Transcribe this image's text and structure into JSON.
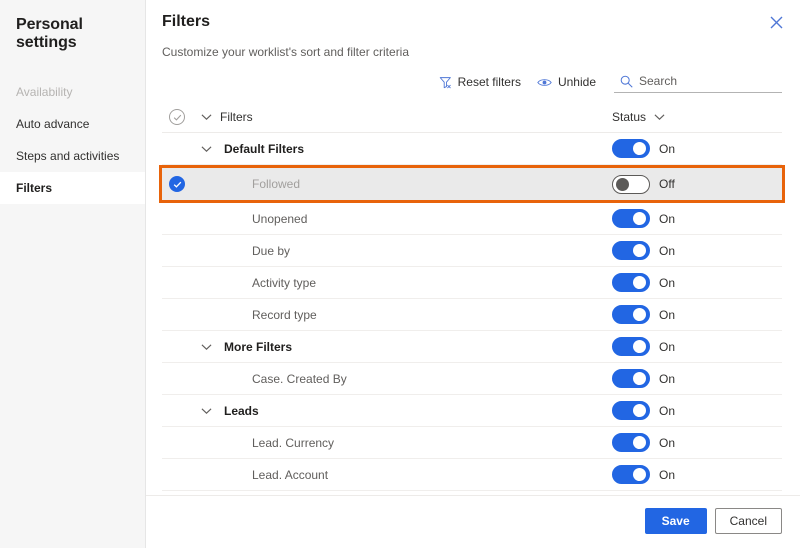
{
  "sidebar": {
    "title": "Personal settings",
    "items": [
      {
        "label": "Availability",
        "state": "disabled"
      },
      {
        "label": "Auto advance",
        "state": "normal"
      },
      {
        "label": "Steps and activities",
        "state": "normal"
      },
      {
        "label": "Filters",
        "state": "selected"
      }
    ]
  },
  "panel": {
    "title": "Filters",
    "subtitle": "Customize your worklist's sort and filter criteria",
    "close_icon": "close-icon"
  },
  "commandbar": {
    "reset_filters": {
      "label": "Reset filters",
      "icon": "filter-clear-icon"
    },
    "unhide": {
      "label": "Unhide",
      "icon": "eye-icon"
    },
    "search": {
      "placeholder": "Search",
      "value": "",
      "icon": "search-icon"
    }
  },
  "grid": {
    "header": {
      "select_all_icon": "circle-check-outline-icon",
      "expand_icon": "chevron-down-icon",
      "name_column": "Filters",
      "status_column": "Status",
      "status_sort_icon": "chevron-down-icon"
    },
    "rows": [
      {
        "label": "Default Filters",
        "level": "group",
        "status": "On",
        "toggle": "on",
        "checked": false,
        "highlighted": false,
        "has_chevron": true
      },
      {
        "label": "Followed",
        "level": "child",
        "status": "Off",
        "toggle": "off",
        "checked": true,
        "highlighted": true,
        "has_chevron": false
      },
      {
        "label": "Unopened",
        "level": "child",
        "status": "On",
        "toggle": "on",
        "checked": false,
        "highlighted": false,
        "has_chevron": false
      },
      {
        "label": "Due by",
        "level": "child",
        "status": "On",
        "toggle": "on",
        "checked": false,
        "highlighted": false,
        "has_chevron": false
      },
      {
        "label": "Activity type",
        "level": "child",
        "status": "On",
        "toggle": "on",
        "checked": false,
        "highlighted": false,
        "has_chevron": false
      },
      {
        "label": "Record type",
        "level": "child",
        "status": "On",
        "toggle": "on",
        "checked": false,
        "highlighted": false,
        "has_chevron": false
      },
      {
        "label": "More Filters",
        "level": "group",
        "status": "On",
        "toggle": "on",
        "checked": false,
        "highlighted": false,
        "has_chevron": true
      },
      {
        "label": "Case. Created By",
        "level": "child",
        "status": "On",
        "toggle": "on",
        "checked": false,
        "highlighted": false,
        "has_chevron": false
      },
      {
        "label": "Leads",
        "level": "group",
        "status": "On",
        "toggle": "on",
        "checked": false,
        "highlighted": false,
        "has_chevron": true
      },
      {
        "label": "Lead. Currency",
        "level": "child",
        "status": "On",
        "toggle": "on",
        "checked": false,
        "highlighted": false,
        "has_chevron": false
      },
      {
        "label": "Lead. Account",
        "level": "child",
        "status": "On",
        "toggle": "on",
        "checked": false,
        "highlighted": false,
        "has_chevron": false
      }
    ]
  },
  "footer": {
    "save_label": "Save",
    "cancel_label": "Cancel"
  },
  "colors": {
    "accent": "#2266e3",
    "highlight_border": "#e8630a",
    "highlight_bg": "#eaeaea",
    "icon_blue": "#4f77d6",
    "sidebar_bg": "#f6f6f6"
  }
}
